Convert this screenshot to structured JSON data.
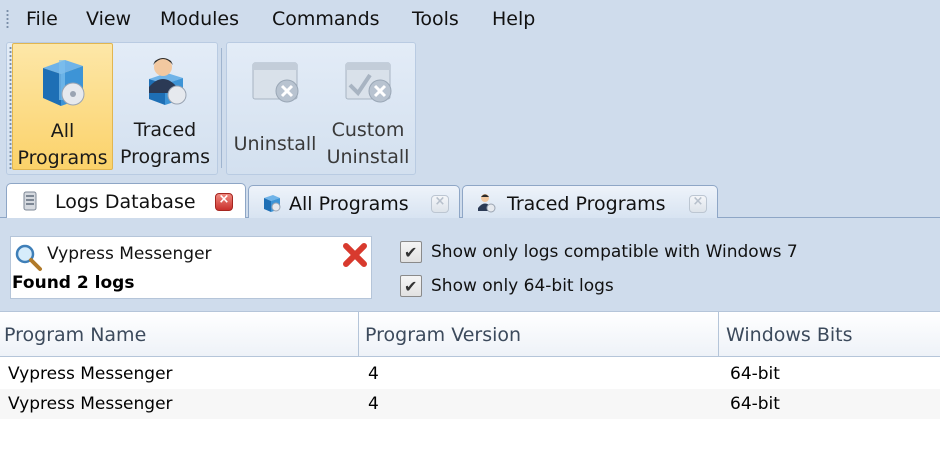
{
  "menu": {
    "items": [
      "File",
      "View",
      "Modules",
      "Commands",
      "Tools",
      "Help"
    ]
  },
  "toolbar": {
    "all_programs": "All\nPrograms",
    "traced_programs": "Traced\nPrograms",
    "uninstall": "Uninstall",
    "custom_uninstall": "Custom\nUninstall"
  },
  "tabs": [
    {
      "label": "Logs Database",
      "icon": "database-icon",
      "close": "close-tab-icon"
    },
    {
      "label": "All Programs",
      "icon": "programs-icon",
      "close": "close-tab-icon"
    },
    {
      "label": "Traced Programs",
      "icon": "user-icon",
      "close": "close-tab-icon"
    }
  ],
  "search": {
    "value": "Vypress Messenger",
    "result": "Found 2 logs"
  },
  "filters": {
    "win7": "Show only logs compatible with Windows 7",
    "bits64": "Show only 64-bit logs"
  },
  "table": {
    "columns": [
      "Program Name",
      "Program Version",
      "Windows Bits"
    ],
    "rows": [
      [
        "Vypress Messenger",
        "4",
        "64-bit"
      ],
      [
        "Vypress Messenger",
        "4",
        "64-bit"
      ]
    ]
  },
  "colors": {
    "accent_active": "#fbd26a",
    "chrome_bg": "#cfdcec",
    "close_red": "#c9302c"
  }
}
